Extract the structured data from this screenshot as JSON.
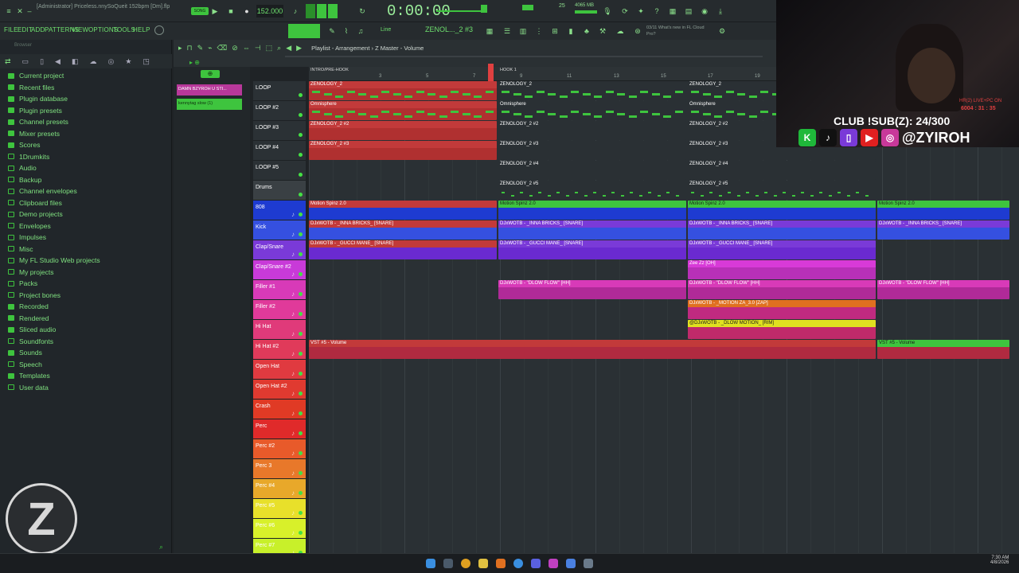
{
  "window": {
    "title": "[Administrator] Priceless.nnySoQueit 152bpm [Dm].flp",
    "bpm": "152.000",
    "time": "0:00:00",
    "hint_title": "ZENOL..._2 #3",
    "news": "03/11 What's new in FL Cloud Pro?",
    "cpu": "25",
    "ram": "4065 MB"
  },
  "menu": [
    "FILE",
    "EDIT",
    "ADD",
    "PATTERNS",
    "VIEW",
    "OPTIONS",
    "TOOLS",
    "HELP"
  ],
  "playlist": {
    "breadcrumb": "Playlist - Arrangement › Z Master - Volume",
    "markers": [
      "INTRO/PRE-HOOK",
      "HOOK 1"
    ],
    "bar_numbers": [
      "3",
      "5",
      "7",
      "9",
      "11",
      "13",
      "15",
      "17",
      "19",
      "21"
    ]
  },
  "browser": {
    "title": "Browser",
    "items": [
      {
        "label": "Current project",
        "icon": "plugin-icon"
      },
      {
        "label": "Recent files",
        "icon": "plugin-icon"
      },
      {
        "label": "Plugin database",
        "icon": "plugin-icon"
      },
      {
        "label": "Plugin presets",
        "icon": "plugin-icon"
      },
      {
        "label": "Channel presets",
        "icon": "plugin-icon"
      },
      {
        "label": "Mixer presets",
        "icon": "plugin-icon"
      },
      {
        "label": "Scores",
        "icon": "plugin-icon"
      },
      {
        "label": "1Drumkits",
        "icon": "folder-icon"
      },
      {
        "label": "Audio",
        "icon": "folder-icon"
      },
      {
        "label": "Backup",
        "icon": "folder-icon"
      },
      {
        "label": "Channel envelopes",
        "icon": "folder-icon"
      },
      {
        "label": "Clipboard files",
        "icon": "folder-icon"
      },
      {
        "label": "Demo projects",
        "icon": "folder-icon"
      },
      {
        "label": "Envelopes",
        "icon": "folder-icon"
      },
      {
        "label": "Impulses",
        "icon": "folder-icon"
      },
      {
        "label": "Misc",
        "icon": "folder-icon"
      },
      {
        "label": "My FL Studio Web projects",
        "icon": "folder-icon"
      },
      {
        "label": "My projects",
        "icon": "folder-icon"
      },
      {
        "label": "Packs",
        "icon": "folder-icon"
      },
      {
        "label": "Project bones",
        "icon": "folder-icon"
      },
      {
        "label": "Recorded",
        "icon": "plugin-icon"
      },
      {
        "label": "Rendered",
        "icon": "plugin-icon"
      },
      {
        "label": "Sliced audio",
        "icon": "plugin-icon"
      },
      {
        "label": "Soundfonts",
        "icon": "folder-icon"
      },
      {
        "label": "Sounds",
        "icon": "plugin-icon"
      },
      {
        "label": "Speech",
        "icon": "folder-icon"
      },
      {
        "label": "Templates",
        "icon": "plugin-icon"
      },
      {
        "label": "User data",
        "icon": "folder-icon"
      }
    ]
  },
  "patterns": [
    "DAMN BZYROH U STI...",
    "kennytag slow (1)"
  ],
  "tracks": [
    {
      "label": "LOOP",
      "color": "#2b3135"
    },
    {
      "label": "LOOP #2",
      "color": "#2b3135"
    },
    {
      "label": "LOOP #3",
      "color": "#2b3135"
    },
    {
      "label": "LOOP #4",
      "color": "#2b3135"
    },
    {
      "label": "LOOP #5",
      "color": "#2b3135"
    },
    {
      "label": "Drums",
      "color": "#3a4044"
    },
    {
      "label": "808",
      "color": "#1e3bd1"
    },
    {
      "label": "Kick",
      "color": "#3550e0"
    },
    {
      "label": "Clap/Snare",
      "color": "#7a3ad8"
    },
    {
      "label": "Clap/Snare #2",
      "color": "#c83ad8"
    },
    {
      "label": "Filler #1",
      "color": "#d83ab8"
    },
    {
      "label": "Filler #2",
      "color": "#e03a9a"
    },
    {
      "label": "Hi Hat",
      "color": "#e03a7a"
    },
    {
      "label": "Hi Hat #2",
      "color": "#e03a5a"
    },
    {
      "label": "Open Hat",
      "color": "#e03a40"
    },
    {
      "label": "Open Hat #2",
      "color": "#e03a30"
    },
    {
      "label": "Crash",
      "color": "#e03a25"
    },
    {
      "label": "Perc",
      "color": "#e02a2a"
    },
    {
      "label": "Perc #2",
      "color": "#e85a2a"
    },
    {
      "label": "Perc 3",
      "color": "#e8782a"
    },
    {
      "label": "Perc #4",
      "color": "#e8a82a"
    },
    {
      "label": "Perc #5",
      "color": "#e8e02a"
    },
    {
      "label": "Perc #6",
      "color": "#d8f02a"
    },
    {
      "label": "Perc #7",
      "color": "#c8f02a"
    }
  ],
  "clips": {
    "zenology2": "ZENOLOGY_2",
    "omnisphere": "Omnisphere",
    "zenology2_2": "ZENOLOGY_2 #2",
    "zenology2_3": "ZENOLOGY_2 #3",
    "zenology2_4": "ZENOLOGY_2 #4",
    "zenology2_5": "ZENOLOGY_2 #5",
    "motion_spinz": "Motion Spinz 2.0",
    "inna_bricks": "DJxWOTB - _INNA BRICKS_ [SNARE]",
    "gucci_mane": "DJxWOTB - _GUCCI MANE_ [SNARE]",
    "zee_oh": "Zee Zz [OH]",
    "dlow_flow": "DJxWOTB - \"DLOW FLOW\" [HH]",
    "motion_zap": "DJxWOTB - _MOTION ZA_3.0 [ZAP]",
    "dlow_motion": "@DJxWOTB - _DLOW MOTION_ [RIM]",
    "vst_volume": "VST #5 - Volume"
  },
  "stream": {
    "club_text": "CLUB !SUB(Z): 24/300",
    "handle": "@ZYIROH",
    "overlay_top": "HR(2) LIVE+PC ON",
    "overlay_time": "6004 : 31 : 35",
    "logo": "Z"
  },
  "taskbar": {
    "time": "7:30 AM",
    "date": "4/8/2026"
  }
}
